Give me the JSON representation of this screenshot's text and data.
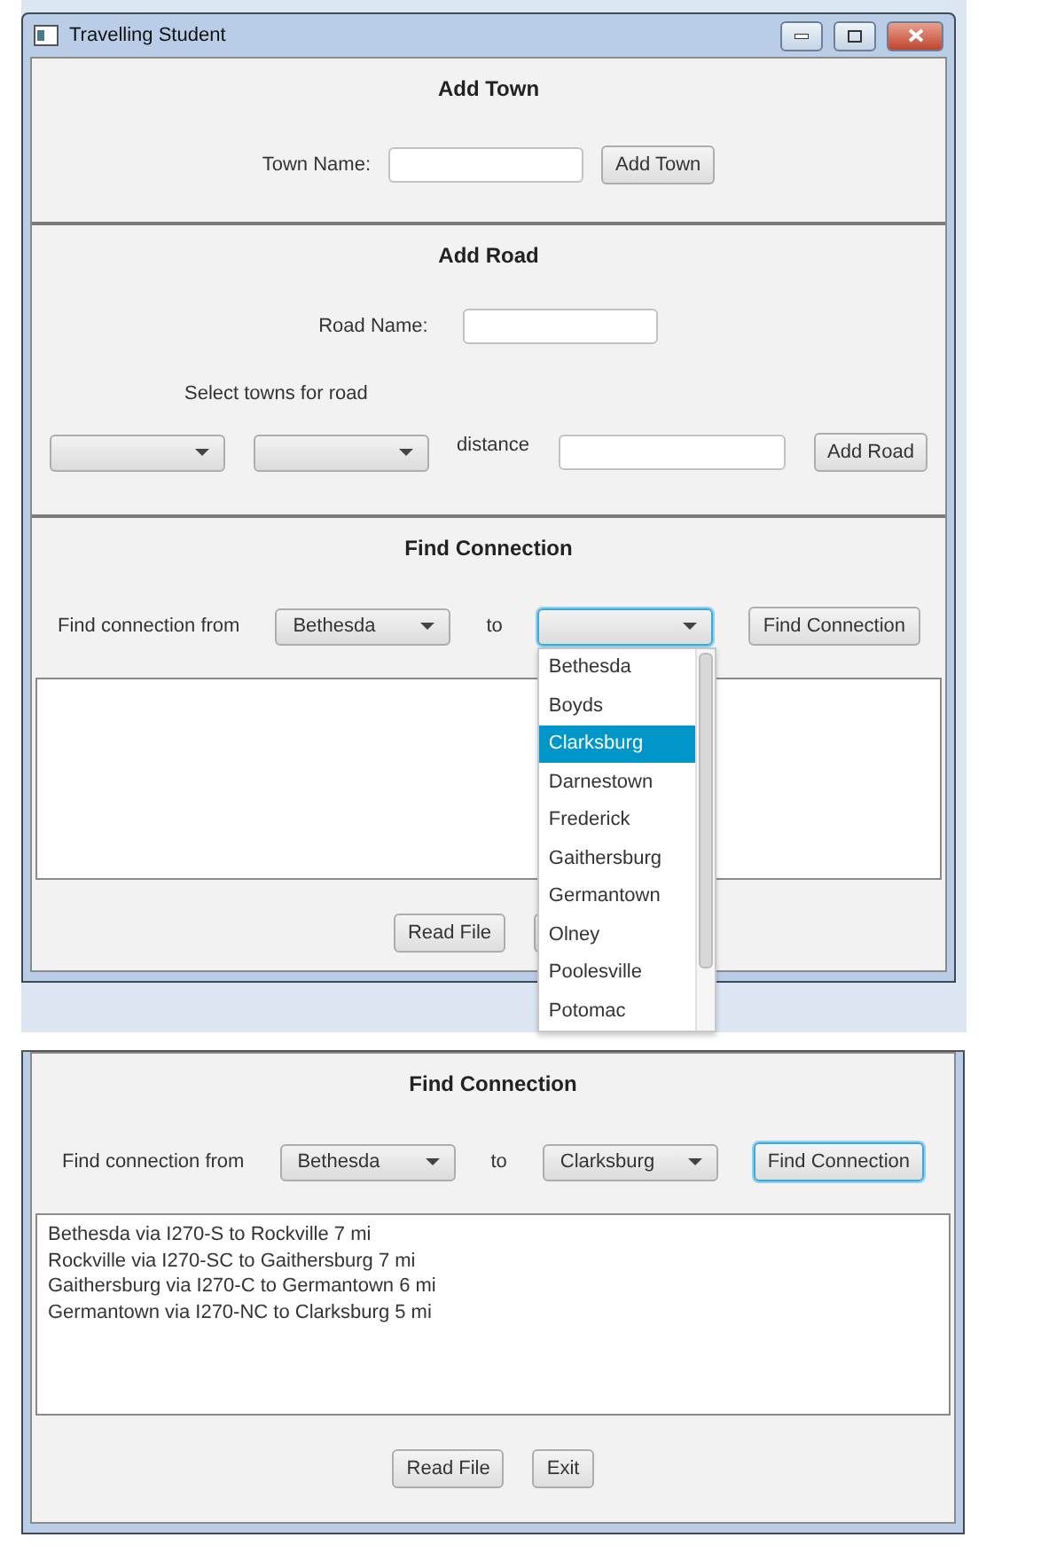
{
  "window": {
    "title": "Travelling Student"
  },
  "add_town": {
    "heading": "Add Town",
    "label": "Town Name:",
    "button": "Add Town"
  },
  "add_road": {
    "heading": "Add Road",
    "label": "Road Name:",
    "select_label": "Select towns for road",
    "distance_label": "distance",
    "button": "Add Road"
  },
  "find_connection": {
    "heading": "Find Connection",
    "from_label": "Find connection from",
    "from_combo": {
      "value": "Bethesda",
      "focused": false
    },
    "to_label": "to",
    "to_combo": {
      "focused": true
    },
    "button": {
      "label": "Find Connection",
      "focused": false
    },
    "dropdown": {
      "items": [
        {
          "label": "Bethesda",
          "selected": false
        },
        {
          "label": "Boyds",
          "selected": false
        },
        {
          "label": "Clarksburg",
          "selected": true
        },
        {
          "label": "Darnestown",
          "selected": false
        },
        {
          "label": "Frederick",
          "selected": false
        },
        {
          "label": "Gaithersburg",
          "selected": false
        },
        {
          "label": "Germantown",
          "selected": false
        },
        {
          "label": "Olney",
          "selected": false
        },
        {
          "label": "Poolesville",
          "selected": false
        },
        {
          "label": "Potomac",
          "selected": false
        }
      ]
    },
    "footer_button": "Read File"
  },
  "result_view": {
    "heading": "Find Connection",
    "from_label": "Find connection from",
    "from_combo": {
      "value": "Bethesda",
      "focused": false
    },
    "to_label": "to",
    "to_combo": {
      "value": "Clarksburg",
      "focused": false
    },
    "button": {
      "label": "Find Connection",
      "focused": true
    },
    "results": [
      "Bethesda via I270-S to Rockville 7 mi",
      "Rockville via I270-SC to Gaithersburg 7 mi",
      "Gaithersburg via I270-C to Germantown 6 mi",
      "Germantown via I270-NC to Clarksburg 5 mi"
    ],
    "buttons": [
      "Read File",
      "Exit"
    ]
  }
}
